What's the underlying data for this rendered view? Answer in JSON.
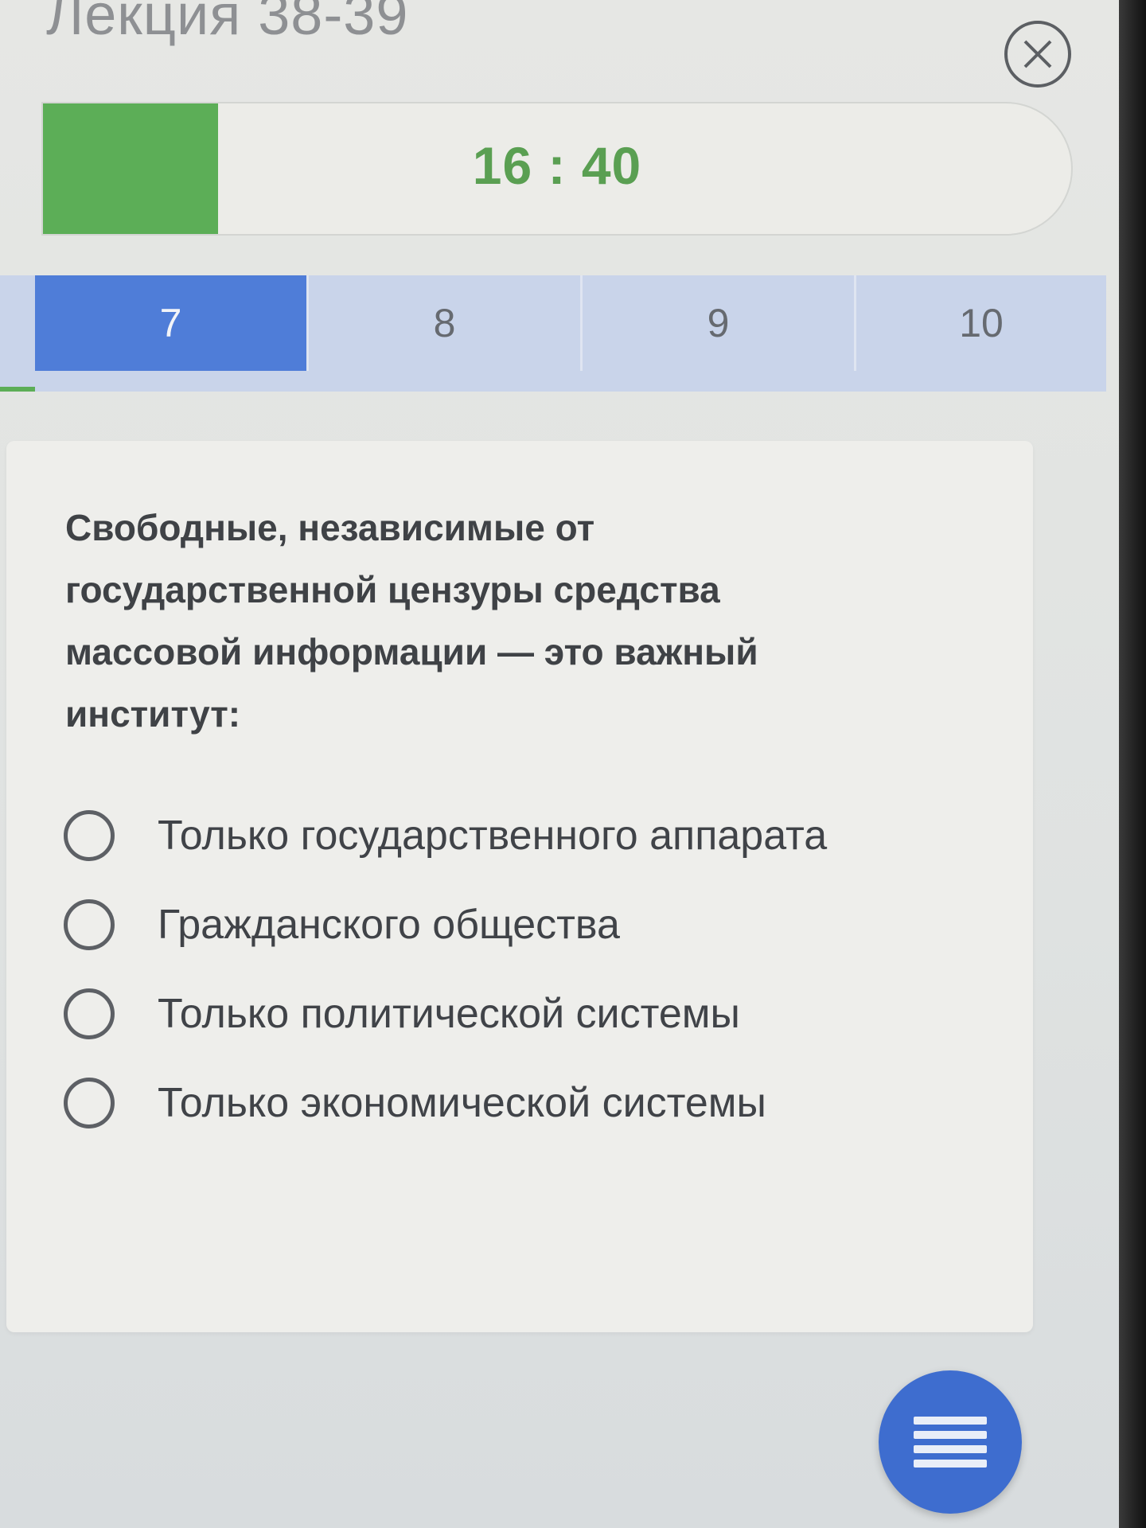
{
  "header": {
    "title": "Лекция 38-39",
    "close_icon": "close-icon"
  },
  "timer": {
    "time": "16 : 40",
    "progress": 0.17,
    "fill_color": "#5cae57"
  },
  "tabs": {
    "items": [
      {
        "label": "7",
        "active": true
      },
      {
        "label": "8",
        "active": false
      },
      {
        "label": "9",
        "active": false
      },
      {
        "label": "10",
        "active": false
      }
    ],
    "active_color": "#4f7dd8"
  },
  "question": {
    "text": "Свободные, независимые от государственной цензуры средства массовой информации — это важный институт:",
    "options": [
      {
        "label": "Только государственного аппарата"
      },
      {
        "label": "Гражданского общества"
      },
      {
        "label": "Только политической системы"
      },
      {
        "label": "Только экономической системы"
      }
    ]
  },
  "fab": {
    "icon": "menu-icon",
    "color": "#3e6dcf"
  }
}
